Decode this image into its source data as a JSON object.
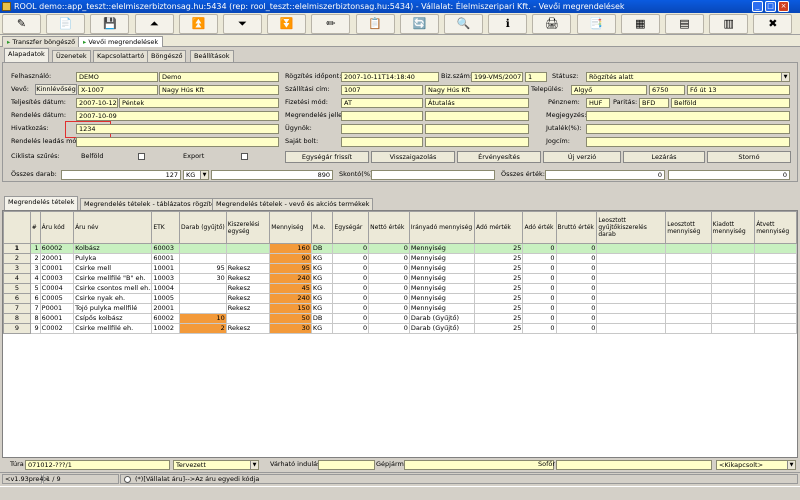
{
  "window": {
    "title": "ROOL demo::app_teszt::elelmiszerbiztonsag.hu:5434 (rep: rool_teszt::elelmiszerbiztonsag.hu:5434) - Vállalat: Élelmiszeripari Kft. - Vevői megrendelések",
    "min": "_",
    "max": "□",
    "close": "×"
  },
  "toolbar": {
    "icons": [
      "✎",
      "📄",
      "💾",
      "⏶",
      "⏫",
      "⏷",
      "⏬",
      "✏",
      "📋",
      "🔄",
      "🔍",
      "ℹ",
      "🖨",
      "📑",
      "▦",
      "▤",
      "▥",
      "✖"
    ]
  },
  "tabs_top": [
    {
      "label": "Transzfer böngésző"
    },
    {
      "label": "Vevői megrendelések"
    }
  ],
  "tabs_form": [
    {
      "label": "Alapadatok"
    },
    {
      "label": "Üzenetek"
    },
    {
      "label": "Kapcsolattartó"
    },
    {
      "label": "Böngésző"
    },
    {
      "label": "Beállítások"
    }
  ],
  "form": {
    "felhasznalo_lbl": "Felhasználó:",
    "felhasznalo": "DEMO",
    "felhasznalo_nev": "Demo",
    "rogzites_lbl": "Rögzítés időpont:",
    "rogzites": "2007-10-11T14:18:40",
    "bizszam_lbl": "Biz.szám:",
    "bizszam": "199-VMS/2007",
    "bizszam2": "1",
    "statusz_lbl": "Státusz:",
    "statusz": "Rögzítés alatt",
    "vevo_lbl": "Vevő:",
    "kinnlevoseg_btn": "Kinnlévőség",
    "vevo_kod": "X-1007",
    "vevo_nev": "Nagy Hús Kft",
    "szall_lbl": "Szállítási cím:",
    "szall_kod": "1007",
    "szall_nev": "Nagy Hús Kft",
    "telepules_lbl": "Település:",
    "telepules": "Algyő",
    "irsz": "6750",
    "utca": "Fő út 13",
    "teljesites_lbl": "Teljesítés dátum:",
    "teljesites": "2007-10-12",
    "teljesites_nap": "Péntek",
    "fizmod_lbl": "Fizetési mód:",
    "fizmod_kod": "AT",
    "fizmod": "Átutalás",
    "penznem_lbl": "Pénznem:",
    "penznem": "HUF",
    "paritas_lbl": "Paritás:",
    "paritas_kod": "BFD",
    "paritas": "Belföld",
    "rendeles_lbl": "Rendelés dátum:",
    "rendeles": "2007-10-09",
    "megrjel_lbl": "Megrendelés jelleg:",
    "megjegyzes_lbl": "Megjegyzés:",
    "hivatkozas_lbl": "Hivatkozás:",
    "hivatkozas": "1234",
    "ugynok_lbl": "Ügynök:",
    "jutalek_lbl": "Jutalék(%):",
    "leadas_lbl": "Rendelés leadás mód:",
    "sajatbolt_lbl": "Saját bolt:",
    "jogcim_lbl": "Jogcím:",
    "ciklista_lbl": "Ciklista szűrés:",
    "belfold_lbl": "Belföld",
    "export_lbl": "Export",
    "btn_egysegar": "Egységár frissít",
    "btn_visszaig": "Visszaigazolás",
    "btn_ervenyesites": "Érvényesítés",
    "btn_ujverzio": "Új verzió",
    "btn_lezaras": "Lezárás",
    "btn_storno": "Stornó",
    "osszesdarab_lbl": "Összes darab:",
    "osszesdarab": "127",
    "me": "KG",
    "osszmenny": "890",
    "skonto_lbl": "Skontó(%):",
    "osszesertek_lbl": "Összes érték:",
    "osszesertek1": "0",
    "osszesertek2": "0"
  },
  "tabs_grid": [
    {
      "label": "Megrendelés tételek"
    },
    {
      "label": "Megrendelés tételek - táblázatos rögzítés"
    },
    {
      "label": "Megrendelés tételek - vevő és akciós termékek"
    }
  ],
  "grid": {
    "headers": [
      "#",
      "Áru kód",
      "Áru név",
      "ETK",
      "Darab (gyűjtő)",
      "Kiszerelési egység",
      "Mennyiség",
      "M.e.",
      "Egységár",
      "Nettó érték",
      "Irányadó mennyiség",
      "Adó mérték",
      "Adó érték",
      "Bruttó érték",
      "Leosztott gyűjtőkiszerelés darab",
      "Leosztott mennyiség",
      "Kiadott mennyiség",
      "Átvett mennyiség"
    ],
    "rows": [
      {
        "rn": "1",
        "n": "1",
        "kod": "60002",
        "nev": "Kolbász",
        "etk": "60003",
        "darab": "",
        "kisz": "",
        "menny": "160",
        "me": "DB",
        "ear": "0",
        "netto": "0",
        "irany": "Mennyiség",
        "ado": "25",
        "adoe": "0",
        "brutto": "0"
      },
      {
        "rn": "2",
        "n": "2",
        "kod": "20001",
        "nev": "Pulyka",
        "etk": "60001",
        "darab": "",
        "kisz": "",
        "menny": "90",
        "me": "KG",
        "ear": "0",
        "netto": "0",
        "irany": "Mennyiség",
        "ado": "25",
        "adoe": "0",
        "brutto": "0"
      },
      {
        "rn": "3",
        "n": "3",
        "kod": "C0001",
        "nev": "Csirke mell",
        "etk": "10001",
        "darab": "95",
        "kisz": "Rekesz",
        "menny": "95",
        "me": "KG",
        "ear": "0",
        "netto": "0",
        "irany": "Mennyiség",
        "ado": "25",
        "adoe": "0",
        "brutto": "0"
      },
      {
        "rn": "4",
        "n": "4",
        "kod": "C0003",
        "nev": "Csirke mellfilé \"B\" eh.",
        "etk": "10003",
        "darab": "30",
        "kisz": "Rekesz",
        "menny": "240",
        "me": "KG",
        "ear": "0",
        "netto": "0",
        "irany": "Mennyiség",
        "ado": "25",
        "adoe": "0",
        "brutto": "0"
      },
      {
        "rn": "5",
        "n": "5",
        "kod": "C0004",
        "nev": "Csirke csontos mell eh.",
        "etk": "10004",
        "darab": "",
        "kisz": "Rekesz",
        "menny": "45",
        "me": "KG",
        "ear": "0",
        "netto": "0",
        "irany": "Mennyiség",
        "ado": "25",
        "adoe": "0",
        "brutto": "0"
      },
      {
        "rn": "6",
        "n": "6",
        "kod": "C0005",
        "nev": "Csirke nyak eh.",
        "etk": "10005",
        "darab": "",
        "kisz": "Rekesz",
        "menny": "240",
        "me": "KG",
        "ear": "0",
        "netto": "0",
        "irany": "Mennyiség",
        "ado": "25",
        "adoe": "0",
        "brutto": "0"
      },
      {
        "rn": "7",
        "n": "7",
        "kod": "P0001",
        "nev": "Tojó pulyka mellfilé",
        "etk": "20001",
        "darab": "",
        "kisz": "Rekesz",
        "menny": "150",
        "me": "KG",
        "ear": "0",
        "netto": "0",
        "irany": "Mennyiség",
        "ado": "25",
        "adoe": "0",
        "brutto": "0"
      },
      {
        "rn": "8",
        "n": "8",
        "kod": "60001",
        "nev": "Csípős kolbász",
        "etk": "60002",
        "darab": "10",
        "kisz": "",
        "menny": "50",
        "me": "DB",
        "ear": "0",
        "netto": "0",
        "irany": "Darab (Gyűjtő)",
        "ado": "25",
        "adoe": "0",
        "brutto": "0"
      },
      {
        "rn": "9",
        "n": "9",
        "kod": "C0002",
        "nev": "Csirke mellfilé eh.",
        "etk": "10002",
        "darab": "2",
        "kisz": "Rekesz",
        "menny": "30",
        "me": "KG",
        "ear": "0",
        "netto": "0",
        "irany": "Darab (Gyűjtő)",
        "ado": "25",
        "adoe": "0",
        "brutto": "0"
      }
    ]
  },
  "filter": {
    "tura_lbl": "Túra",
    "tura": "071012-???/1",
    "tervezett": "Tervezett",
    "varhato_lbl": "Várható indulás",
    "gepjarmu_lbl": "Gépjármű",
    "sofor_lbl": "Sofőr",
    "kikapcsolt": "<Kikapcsolt>"
  },
  "status": {
    "version": "<v1.93pre4>",
    "rec": "1 / 9",
    "hint": "(*)[Vállalat áru]-->Az áru egyedi kódja"
  }
}
